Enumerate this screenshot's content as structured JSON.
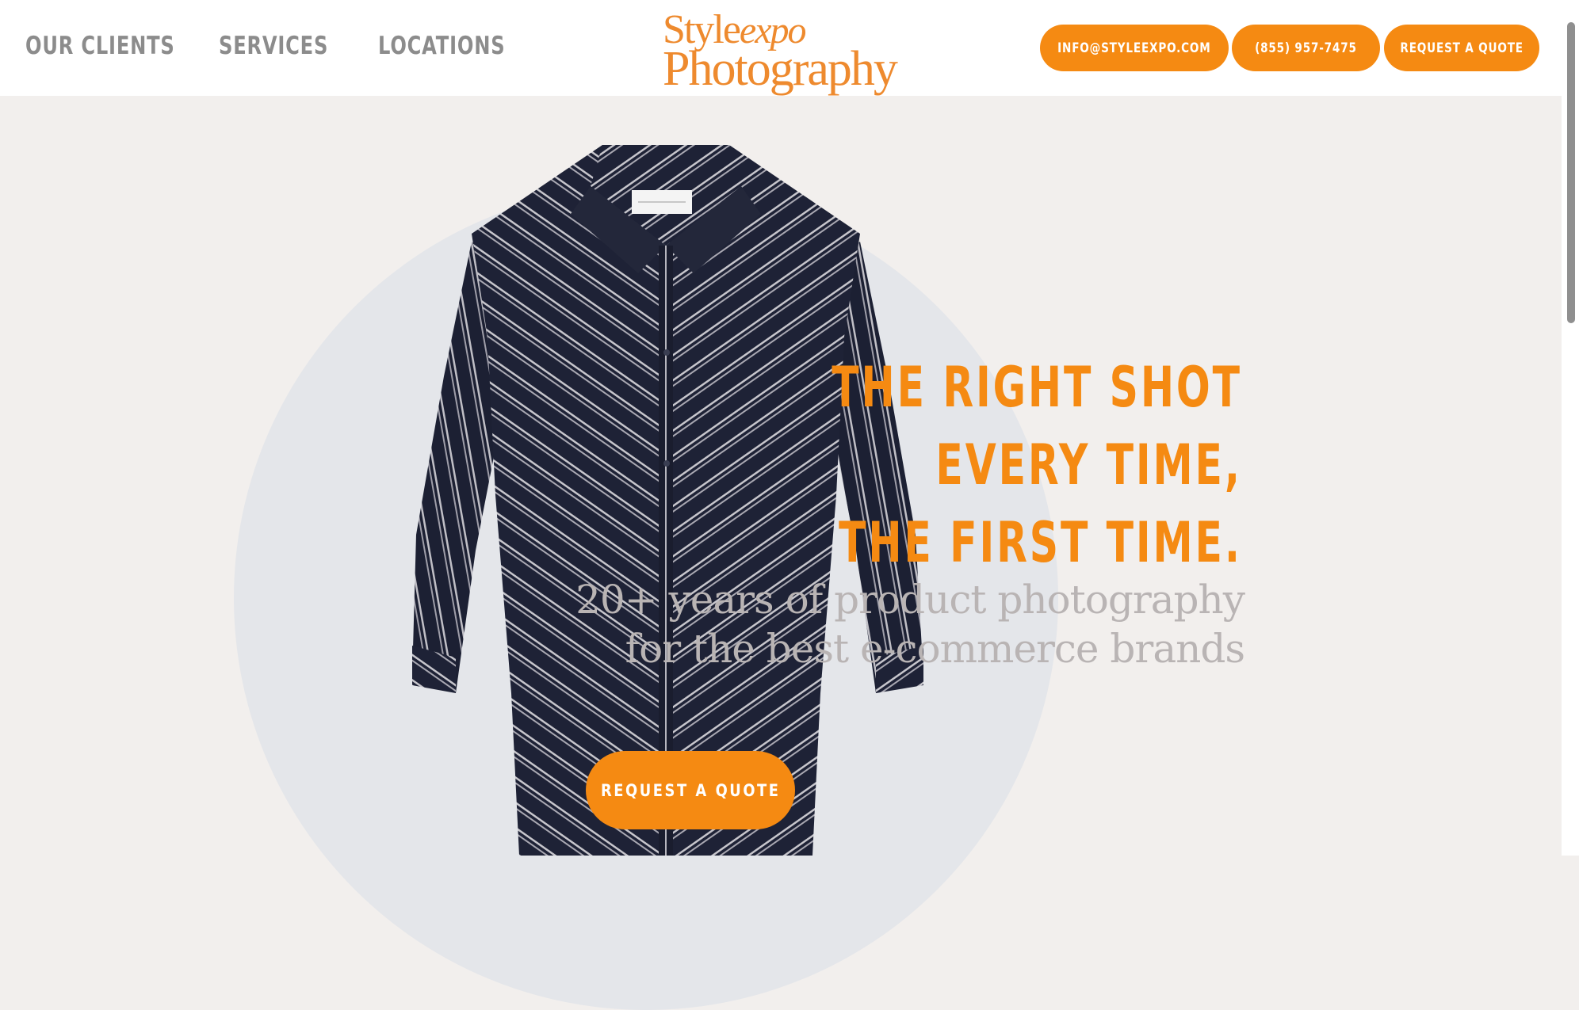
{
  "nav": {
    "items": [
      {
        "label": "OUR CLIENTS"
      },
      {
        "label": "SERVICES"
      },
      {
        "label": "LOCATIONS"
      }
    ]
  },
  "logo": {
    "line1_a": "Style",
    "line1_b": "expo",
    "line2": "Photography"
  },
  "contact": {
    "email": "INFO@STYLEEXPO.COM",
    "phone": "(855) 957-7475",
    "quote": "REQUEST A QUOTE"
  },
  "hero": {
    "headline": [
      "THE RIGHT SHOT",
      "EVERY TIME,",
      "THE FIRST TIME."
    ],
    "subtitle": [
      "20+ years of product photography",
      "for the best e-commerce brands"
    ],
    "cta": "REQUEST A QUOTE"
  },
  "colors": {
    "accent": "#f58a12",
    "logo": "#ee8a2e",
    "nav_text": "#8c8c8c",
    "subtitle_text": "#b9b4b4",
    "background": "#f2efed",
    "circle": "#e4e6ea",
    "shirt": "#1e2236"
  }
}
